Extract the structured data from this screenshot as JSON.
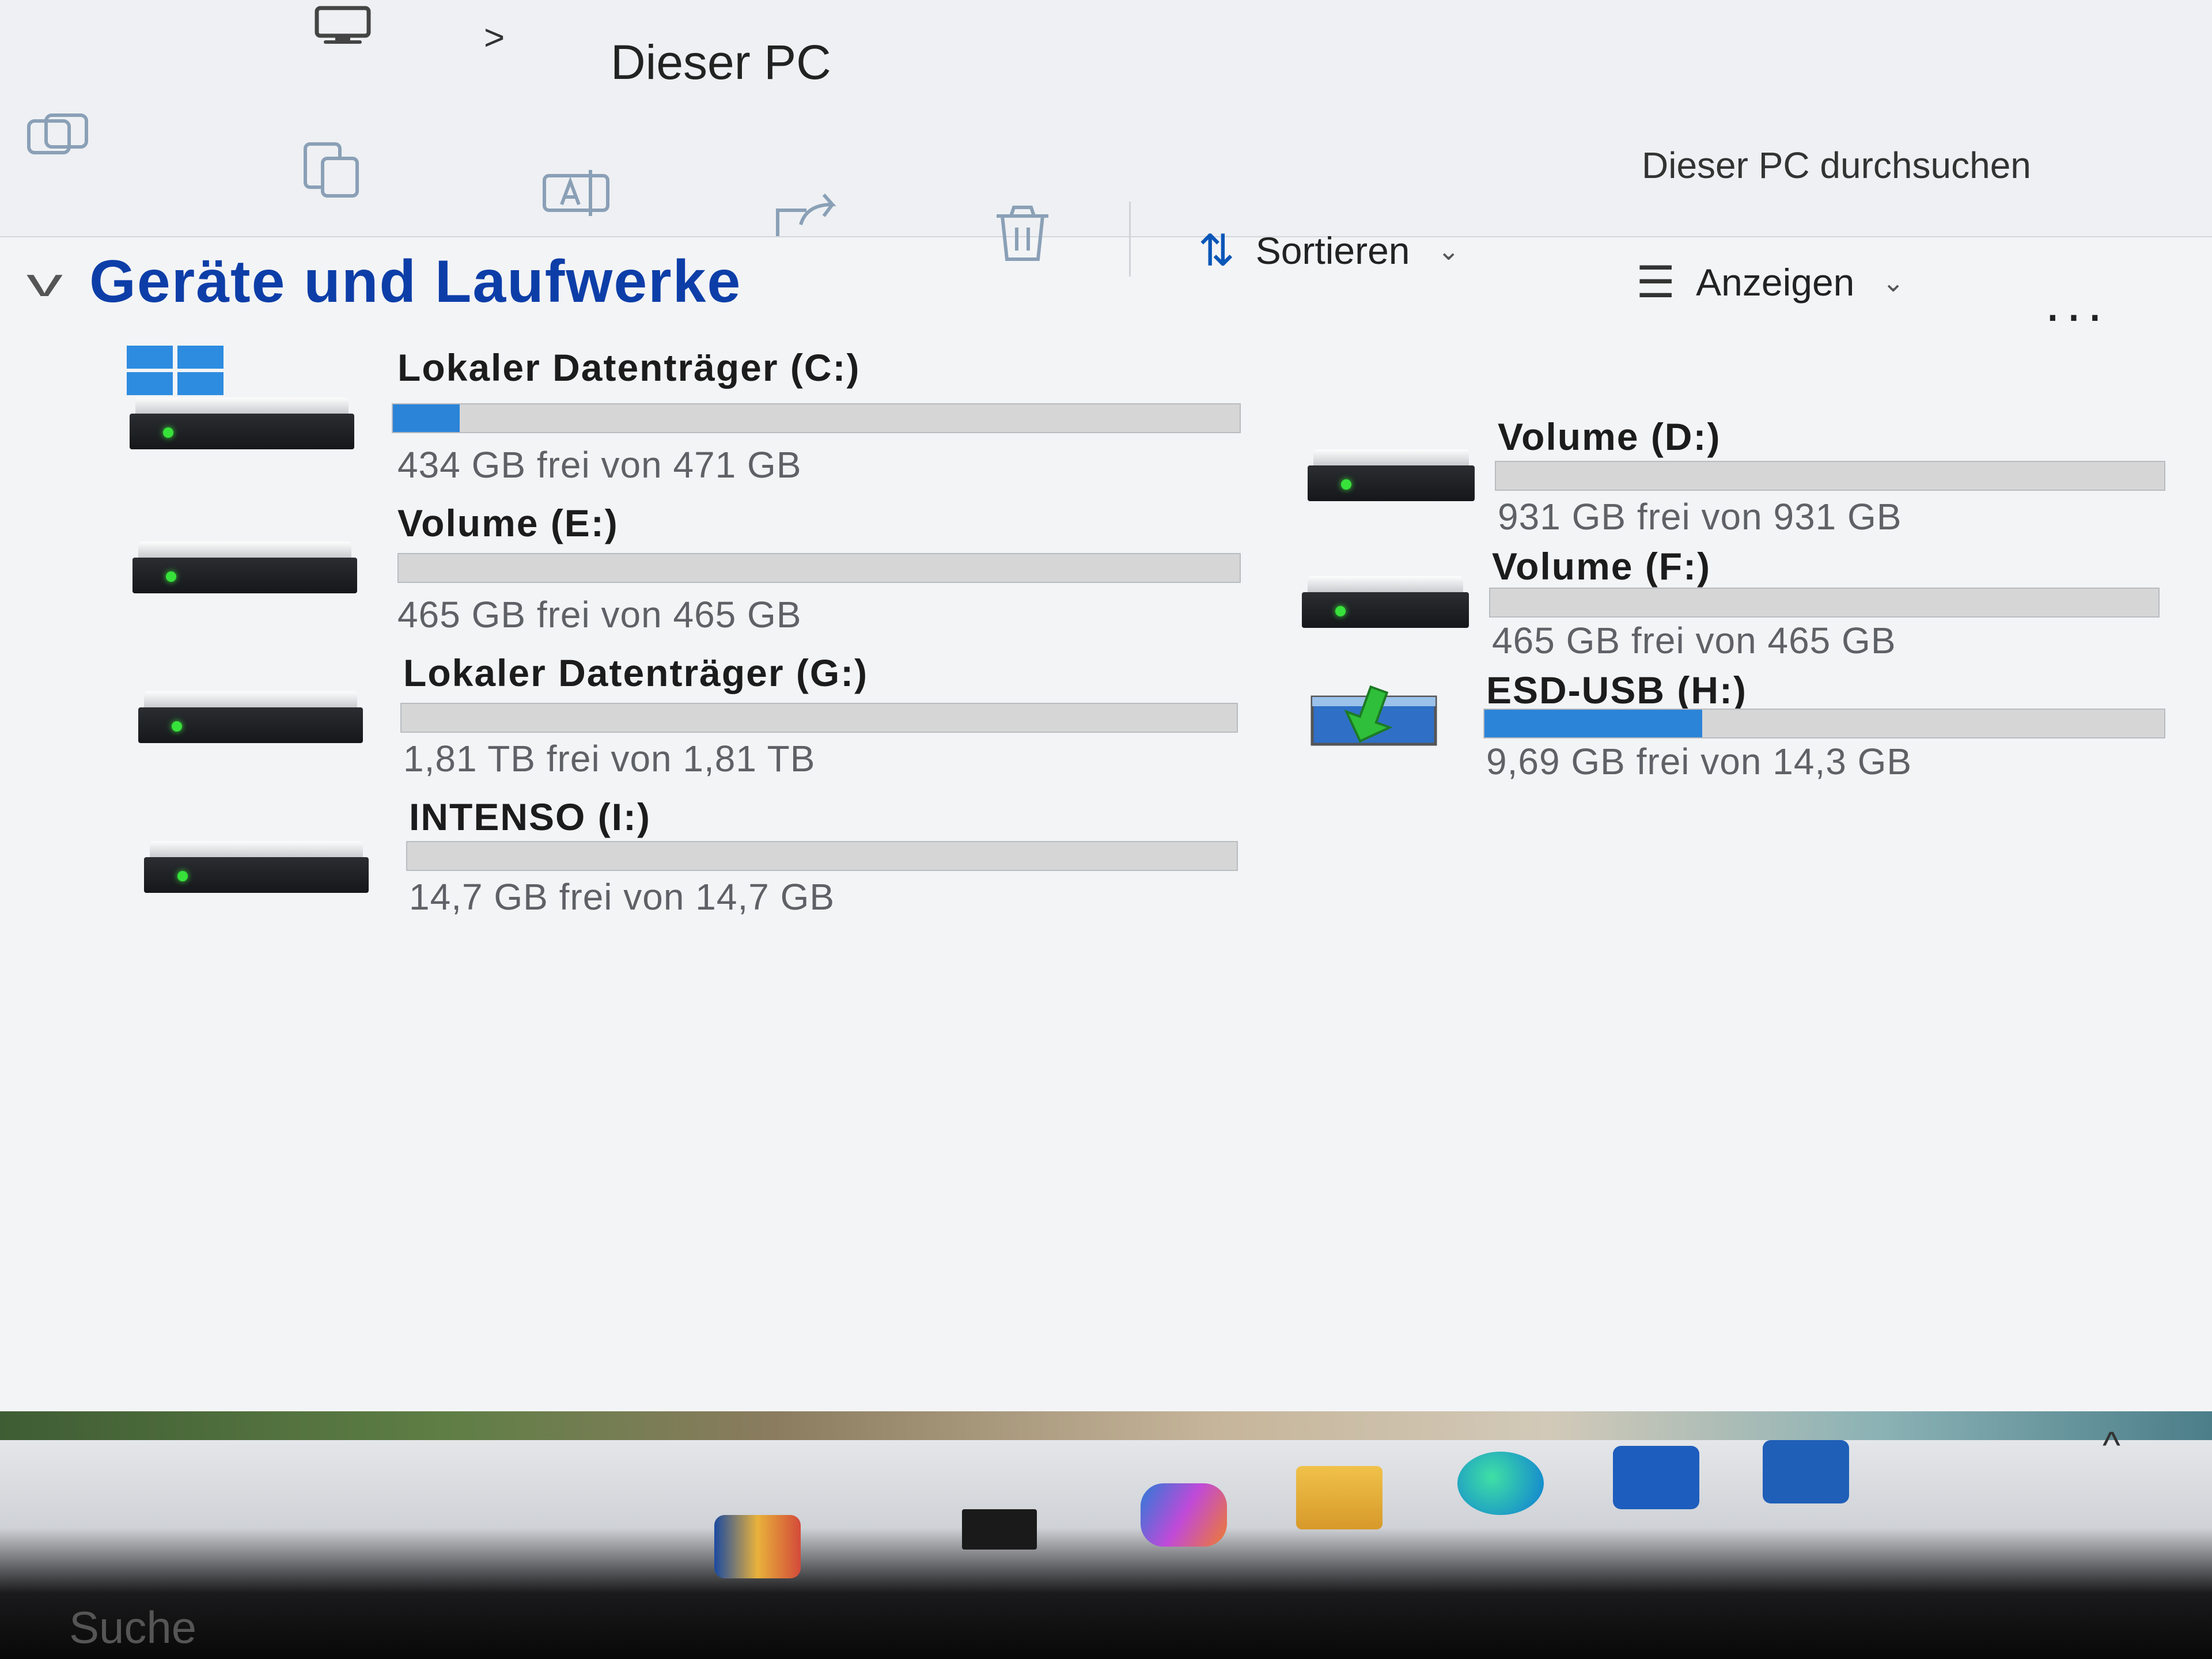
{
  "address_bar": {
    "separator": ">",
    "location": "Dieser PC"
  },
  "toolbar": {
    "sort_label": "Sortieren",
    "view_label": "Anzeigen",
    "more_label": "...",
    "search_placeholder": "Dieser PC durchsuchen"
  },
  "group": {
    "title": "Geräte und Laufwerke"
  },
  "drives": [
    {
      "name": "Lokaler Datenträger (C:)",
      "free_text": "434 GB frei von 471 GB",
      "used_fraction": 0.079,
      "icon": "windows-drive-icon"
    },
    {
      "name": "Volume (D:)",
      "free_text": "931 GB frei von 931 GB",
      "used_fraction": 0.0,
      "icon": "hard-drive-icon"
    },
    {
      "name": "Volume (E:)",
      "free_text": "465 GB frei von 465 GB",
      "used_fraction": 0.0,
      "icon": "hard-drive-icon"
    },
    {
      "name": "Volume (F:)",
      "free_text": "465 GB frei von 465 GB",
      "used_fraction": 0.0,
      "icon": "hard-drive-icon"
    },
    {
      "name": "Lokaler Datenträger (G:)",
      "free_text": "1,81 TB frei von 1,81 TB",
      "used_fraction": 0.0,
      "icon": "hard-drive-icon"
    },
    {
      "name": "ESD-USB (H:)",
      "free_text": "9,69 GB frei von 14,3 GB",
      "used_fraction": 0.32,
      "icon": "usb-install-icon"
    },
    {
      "name": "INTENSO (I:)",
      "free_text": "14,7 GB frei von 14,7 GB",
      "used_fraction": 0.0,
      "icon": "hard-drive-icon"
    }
  ],
  "taskbar": {
    "search_label": "Suche"
  },
  "colors": {
    "accent": "#2b84d8",
    "group_title": "#0d3ea8",
    "led": "#37e23a"
  }
}
